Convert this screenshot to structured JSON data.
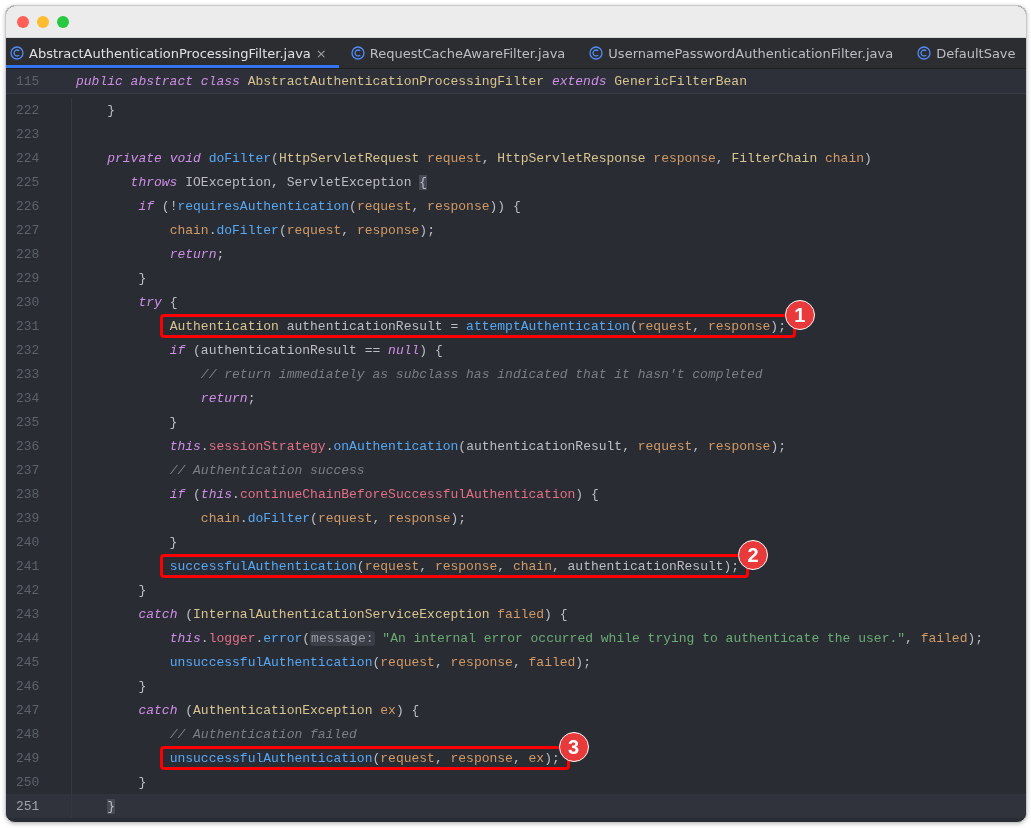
{
  "window": {
    "controls": [
      {
        "color": "#fe5f57"
      },
      {
        "color": "#febc2e"
      },
      {
        "color": "#28c840"
      }
    ]
  },
  "tabs": [
    {
      "label": "AbstractAuthenticationProcessingFilter.java",
      "selected": true,
      "close": "×"
    },
    {
      "label": "RequestCacheAwareFilter.java",
      "selected": false
    },
    {
      "label": "UsernamePasswordAuthenticationFilter.java",
      "selected": false
    },
    {
      "label": "DefaultSave",
      "selected": false
    }
  ],
  "sticky_header": {
    "number": "115",
    "tokens": [
      {
        "kind": "kw",
        "text": "public abstract class "
      },
      {
        "kind": "type",
        "text": "AbstractAuthenticationProcessingFilter "
      },
      {
        "kind": "kw",
        "text": "extends "
      },
      {
        "kind": "type",
        "text": "GenericFilterBean"
      }
    ]
  },
  "lines": [
    {
      "number": "222",
      "current": false,
      "tokens": [
        {
          "kind": "plain",
          "text": "    }"
        }
      ]
    },
    {
      "number": "223",
      "current": false
    },
    {
      "number": "224",
      "current": false,
      "tokens": [
        {
          "kind": "kw",
          "text": "    private void "
        },
        {
          "kind": "fn",
          "text": "doFilter"
        },
        {
          "kind": "plain",
          "text": "("
        },
        {
          "kind": "type",
          "text": "HttpServletRequest "
        },
        {
          "kind": "param",
          "text": "request"
        },
        {
          "kind": "plain",
          "text": ", "
        },
        {
          "kind": "type",
          "text": "HttpServletResponse "
        },
        {
          "kind": "param",
          "text": "response"
        },
        {
          "kind": "plain",
          "text": ", "
        },
        {
          "kind": "type",
          "text": "FilterChain "
        },
        {
          "kind": "param",
          "text": "chain"
        },
        {
          "kind": "plain",
          "text": ")"
        }
      ]
    },
    {
      "number": "225",
      "current": false,
      "tokens": [
        {
          "kind": "kw",
          "text": "       throws"
        },
        {
          "kind": "plain",
          "text": " IOException, ServletException "
        },
        {
          "kind": "brace",
          "text": "{"
        }
      ]
    },
    {
      "number": "226",
      "current": false,
      "tokens": [
        {
          "kind": "kw",
          "text": "        if"
        },
        {
          "kind": "plain",
          "text": " (!"
        },
        {
          "kind": "fn",
          "text": "requiresAuthentication"
        },
        {
          "kind": "plain",
          "text": "("
        },
        {
          "kind": "param",
          "text": "request"
        },
        {
          "kind": "plain",
          "text": ", "
        },
        {
          "kind": "param",
          "text": "response"
        },
        {
          "kind": "plain",
          "text": ")) {"
        }
      ]
    },
    {
      "number": "227",
      "current": false,
      "tokens": [
        {
          "kind": "param",
          "text": "            chain"
        },
        {
          "kind": "plain",
          "text": "."
        },
        {
          "kind": "fn",
          "text": "doFilter"
        },
        {
          "kind": "plain",
          "text": "("
        },
        {
          "kind": "param",
          "text": "request"
        },
        {
          "kind": "plain",
          "text": ", "
        },
        {
          "kind": "param",
          "text": "response"
        },
        {
          "kind": "plain",
          "text": ");"
        }
      ]
    },
    {
      "number": "228",
      "current": false,
      "tokens": [
        {
          "kind": "kw",
          "text": "            return"
        },
        {
          "kind": "plain",
          "text": ";"
        }
      ]
    },
    {
      "number": "229",
      "current": false,
      "tokens": [
        {
          "kind": "plain",
          "text": "        }"
        }
      ]
    },
    {
      "number": "230",
      "current": false,
      "tokens": [
        {
          "kind": "kw",
          "text": "        try"
        },
        {
          "kind": "plain",
          "text": " {"
        }
      ]
    },
    {
      "number": "231",
      "current": false,
      "callout": "1",
      "tokens": [
        {
          "kind": "type",
          "text": "            Authentication"
        },
        {
          "kind": "plain",
          "text": " authenticationResult = "
        },
        {
          "kind": "fn",
          "text": "attemptAuthentication"
        },
        {
          "kind": "plain",
          "text": "("
        },
        {
          "kind": "param",
          "text": "request"
        },
        {
          "kind": "plain",
          "text": ", "
        },
        {
          "kind": "param",
          "text": "response"
        },
        {
          "kind": "plain",
          "text": ");"
        }
      ]
    },
    {
      "number": "232",
      "current": false,
      "tokens": [
        {
          "kind": "kw",
          "text": "            if"
        },
        {
          "kind": "plain",
          "text": " (authenticationResult == "
        },
        {
          "kind": "kw",
          "text": "null"
        },
        {
          "kind": "plain",
          "text": ") {"
        }
      ]
    },
    {
      "number": "233",
      "current": false,
      "tokens": [
        {
          "kind": "comment",
          "text": "                // return immediately as subclass has indicated that it hasn't completed"
        }
      ]
    },
    {
      "number": "234",
      "current": false,
      "tokens": [
        {
          "kind": "kw",
          "text": "                return"
        },
        {
          "kind": "plain",
          "text": ";"
        }
      ]
    },
    {
      "number": "235",
      "current": false,
      "tokens": [
        {
          "kind": "plain",
          "text": "            }"
        }
      ]
    },
    {
      "number": "236",
      "current": false,
      "tokens": [
        {
          "kind": "kw",
          "text": "            this"
        },
        {
          "kind": "plain",
          "text": "."
        },
        {
          "kind": "field",
          "text": "sessionStrategy"
        },
        {
          "kind": "plain",
          "text": "."
        },
        {
          "kind": "fn",
          "text": "onAuthentication"
        },
        {
          "kind": "plain",
          "text": "(authenticationResult, "
        },
        {
          "kind": "param",
          "text": "request"
        },
        {
          "kind": "plain",
          "text": ", "
        },
        {
          "kind": "param",
          "text": "response"
        },
        {
          "kind": "plain",
          "text": ");"
        }
      ]
    },
    {
      "number": "237",
      "current": false,
      "tokens": [
        {
          "kind": "comment",
          "text": "            // Authentication success"
        }
      ]
    },
    {
      "number": "238",
      "current": false,
      "tokens": [
        {
          "kind": "kw",
          "text": "            if"
        },
        {
          "kind": "plain",
          "text": " ("
        },
        {
          "kind": "kw",
          "text": "this"
        },
        {
          "kind": "plain",
          "text": "."
        },
        {
          "kind": "field",
          "text": "continueChainBeforeSuccessfulAuthentication"
        },
        {
          "kind": "plain",
          "text": ") {"
        }
      ]
    },
    {
      "number": "239",
      "current": false,
      "tokens": [
        {
          "kind": "param",
          "text": "                chain"
        },
        {
          "kind": "plain",
          "text": "."
        },
        {
          "kind": "fn",
          "text": "doFilter"
        },
        {
          "kind": "plain",
          "text": "("
        },
        {
          "kind": "param",
          "text": "request"
        },
        {
          "kind": "plain",
          "text": ", "
        },
        {
          "kind": "param",
          "text": "response"
        },
        {
          "kind": "plain",
          "text": ");"
        }
      ]
    },
    {
      "number": "240",
      "current": false,
      "tokens": [
        {
          "kind": "plain",
          "text": "            }"
        }
      ]
    },
    {
      "number": "241",
      "current": false,
      "callout": "2",
      "tokens": [
        {
          "kind": "fn",
          "text": "            successfulAuthentication"
        },
        {
          "kind": "plain",
          "text": "("
        },
        {
          "kind": "param",
          "text": "request"
        },
        {
          "kind": "plain",
          "text": ", "
        },
        {
          "kind": "param",
          "text": "response"
        },
        {
          "kind": "plain",
          "text": ", "
        },
        {
          "kind": "param",
          "text": "chain"
        },
        {
          "kind": "plain",
          "text": ", authenticationResult);"
        }
      ]
    },
    {
      "number": "242",
      "current": false,
      "tokens": [
        {
          "kind": "plain",
          "text": "        }"
        }
      ]
    },
    {
      "number": "243",
      "current": false,
      "tokens": [
        {
          "kind": "kw",
          "text": "        catch"
        },
        {
          "kind": "plain",
          "text": " ("
        },
        {
          "kind": "type",
          "text": "InternalAuthenticationServiceException "
        },
        {
          "kind": "param",
          "text": "failed"
        },
        {
          "kind": "plain",
          "text": ") {"
        }
      ]
    },
    {
      "number": "244",
      "current": false,
      "tokens": [
        {
          "kind": "kw",
          "text": "            this"
        },
        {
          "kind": "plain",
          "text": "."
        },
        {
          "kind": "field",
          "text": "logger"
        },
        {
          "kind": "plain",
          "text": "."
        },
        {
          "kind": "fn",
          "text": "error"
        },
        {
          "kind": "plain",
          "text": "("
        },
        {
          "kind": "hint",
          "text": "message:"
        },
        {
          "kind": "string",
          "text": " \"An internal error occurred while trying to authenticate the user.\""
        },
        {
          "kind": "plain",
          "text": ", "
        },
        {
          "kind": "param",
          "text": "failed"
        },
        {
          "kind": "plain",
          "text": ");"
        }
      ]
    },
    {
      "number": "245",
      "current": false,
      "tokens": [
        {
          "kind": "fn",
          "text": "            unsuccessfulAuthentication"
        },
        {
          "kind": "plain",
          "text": "("
        },
        {
          "kind": "param",
          "text": "request"
        },
        {
          "kind": "plain",
          "text": ", "
        },
        {
          "kind": "param",
          "text": "response"
        },
        {
          "kind": "plain",
          "text": ", "
        },
        {
          "kind": "param",
          "text": "failed"
        },
        {
          "kind": "plain",
          "text": ");"
        }
      ]
    },
    {
      "number": "246",
      "current": false,
      "tokens": [
        {
          "kind": "plain",
          "text": "        }"
        }
      ]
    },
    {
      "number": "247",
      "current": false,
      "tokens": [
        {
          "kind": "kw",
          "text": "        catch"
        },
        {
          "kind": "plain",
          "text": " ("
        },
        {
          "kind": "type",
          "text": "AuthenticationException "
        },
        {
          "kind": "param",
          "text": "ex"
        },
        {
          "kind": "plain",
          "text": ") {"
        }
      ]
    },
    {
      "number": "248",
      "current": false,
      "tokens": [
        {
          "kind": "comment",
          "text": "            // Authentication failed"
        }
      ]
    },
    {
      "number": "249",
      "current": false,
      "callout": "3",
      "tokens": [
        {
          "kind": "fn",
          "text": "            unsuccessfulAuthentication"
        },
        {
          "kind": "plain",
          "text": "("
        },
        {
          "kind": "param",
          "text": "request"
        },
        {
          "kind": "plain",
          "text": ", "
        },
        {
          "kind": "param",
          "text": "response"
        },
        {
          "kind": "plain",
          "text": ", "
        },
        {
          "kind": "param",
          "text": "ex"
        },
        {
          "kind": "plain",
          "text": ");"
        }
      ]
    },
    {
      "number": "250",
      "current": false,
      "tokens": [
        {
          "kind": "plain",
          "text": "        }"
        }
      ]
    },
    {
      "number": "251",
      "current": true,
      "tokens": [
        {
          "kind": "brace",
          "text": "    }"
        }
      ]
    }
  ]
}
